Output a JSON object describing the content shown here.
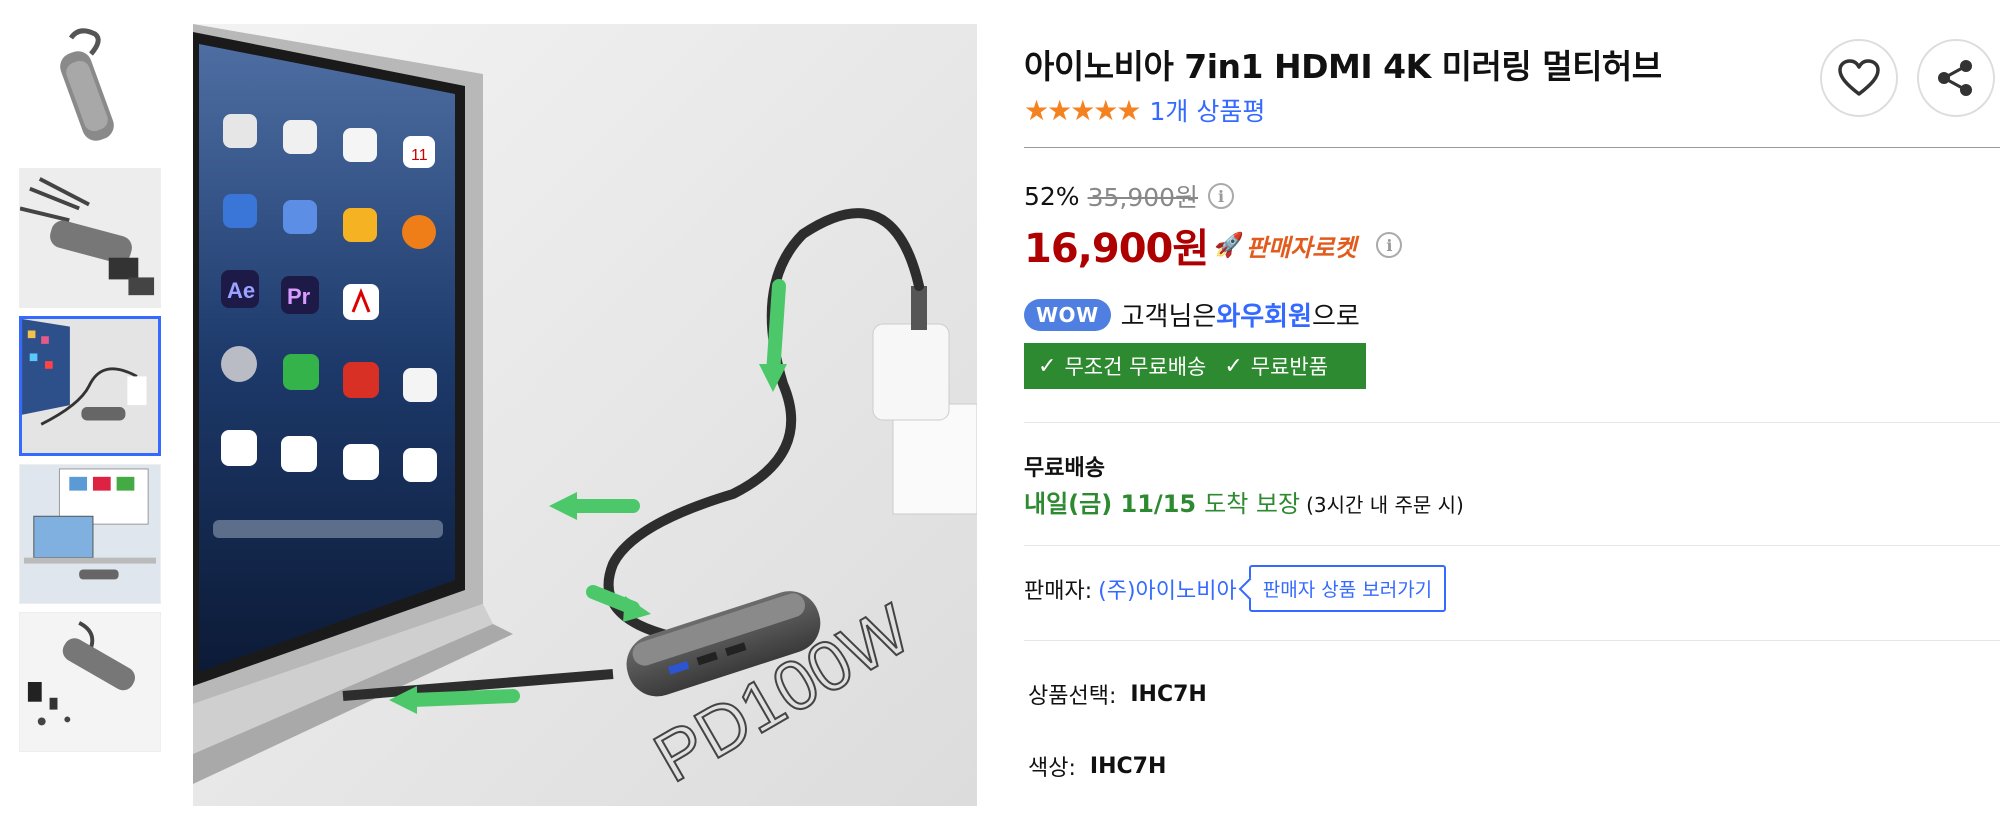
{
  "thumbnails": [
    {
      "alt": "hub-top-view"
    },
    {
      "alt": "hub-ports-cables"
    },
    {
      "alt": "laptop-connection"
    },
    {
      "alt": "desk-setup"
    },
    {
      "alt": "hub-accessories"
    }
  ],
  "active_thumbnail": 2,
  "main_image": {
    "hub_label": "PD100W"
  },
  "product": {
    "title": "아이노비아 7in1 HDMI 4K 미러링 멀티허브",
    "stars": "★★★★★",
    "review_count": "1개 상품평",
    "discount_rate": "52%",
    "original_price": "35,900원",
    "sale_price": "16,900원",
    "rocket_label": "판매자로켓",
    "info_icon": "i"
  },
  "wow": {
    "badge": "WOW",
    "text_before": "고객님은 ",
    "member": "와우회원",
    "text_after": "으로"
  },
  "benefits": {
    "free_shipping": "무조건 무료배송",
    "free_return": "무료반품"
  },
  "shipping": {
    "title": "무료배송",
    "date": "내일(금) 11/15",
    "guarantee": "도착 보장",
    "condition": "(3시간 내 주문 시)"
  },
  "seller": {
    "label": "판매자:",
    "name": "(주)아이노비아",
    "button": "판매자 상품 보러가기"
  },
  "options": [
    {
      "label": "상품선택:",
      "value": "IHC7H"
    },
    {
      "label": "색상:",
      "value": "IHC7H"
    }
  ],
  "colors": {
    "accent_blue": "#346aff",
    "price_red": "#ae0000",
    "rocket_orange": "#e25a1c",
    "benefit_green": "#2e8a31",
    "star_orange": "#f58220"
  }
}
